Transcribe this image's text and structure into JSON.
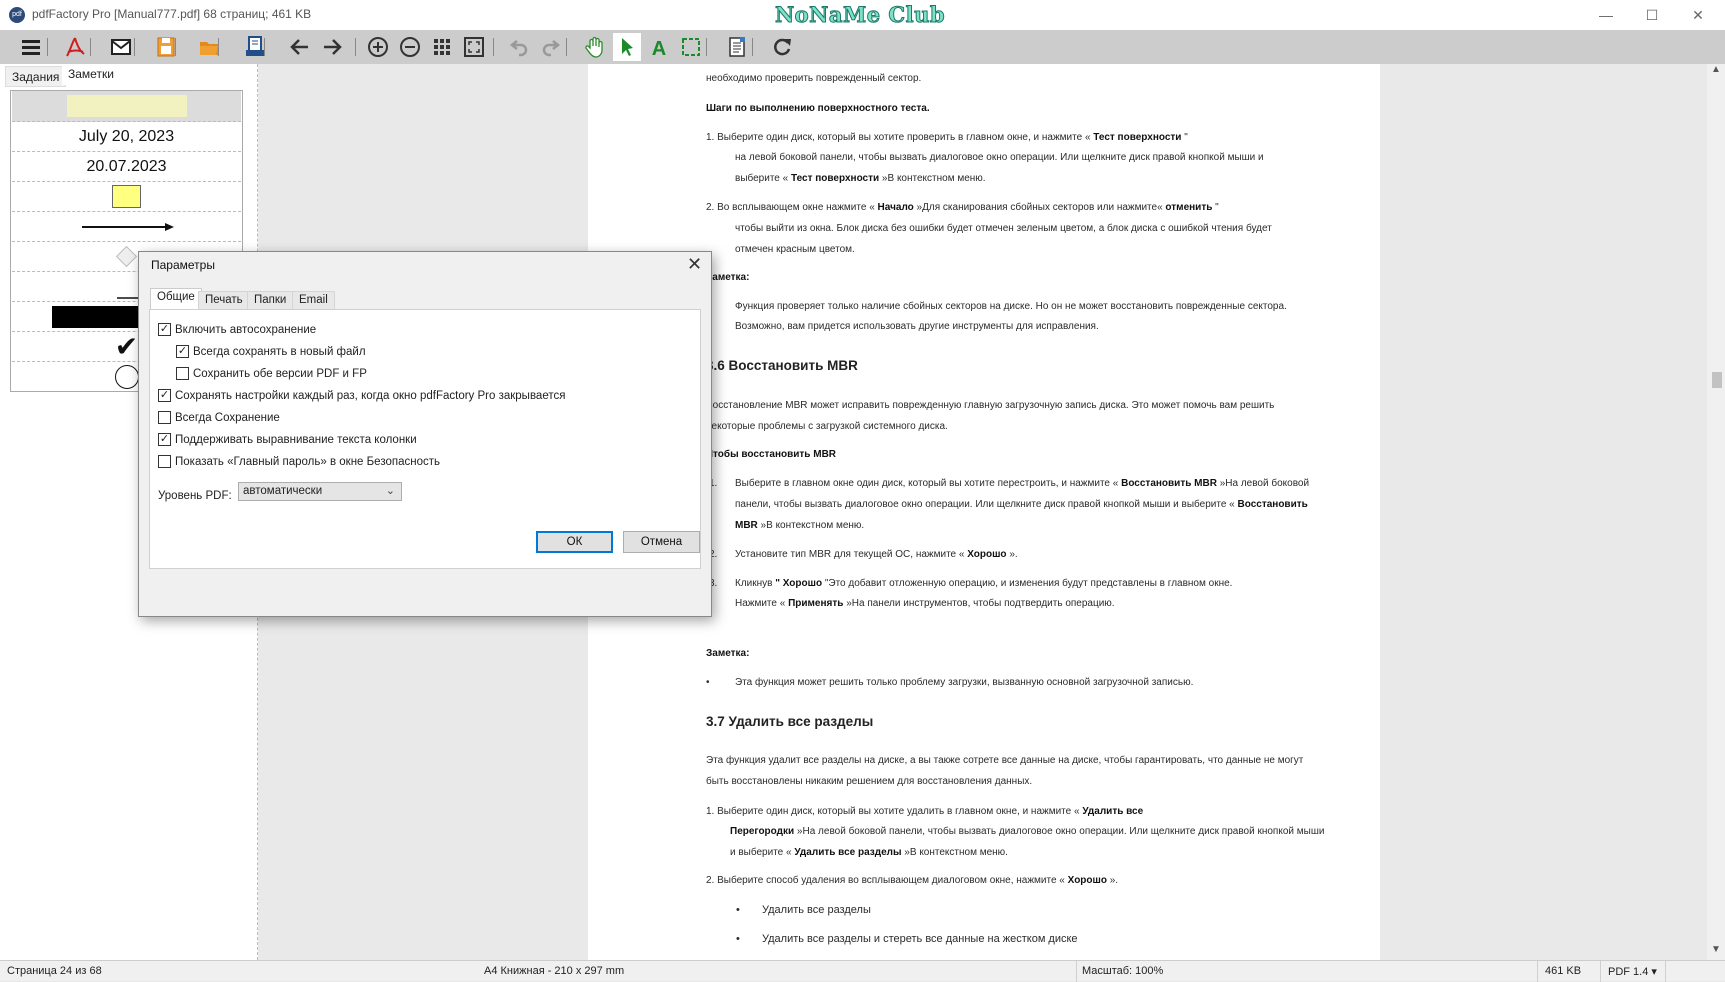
{
  "window": {
    "app_icon_text": "pdf",
    "title": "pdfFactory Pro [Manual777.pdf] 68 страниц; 461 KB",
    "watermark": "NoNaMe Club",
    "controls": {
      "minimize": "—",
      "maximize": "☐",
      "close": "✕"
    }
  },
  "toolbar": {
    "icons": [
      "menu-icon",
      "pdf-icon",
      "email-icon",
      "save-icon",
      "open-folder-icon",
      "print-icon",
      "back-icon",
      "forward-icon",
      "zoom-in-icon",
      "zoom-out-icon",
      "thumbnails-icon",
      "fit-page-icon",
      "undo-icon",
      "redo-icon",
      "hand-icon",
      "select-arrow-icon",
      "text-tool-icon",
      "selection-rect-icon",
      "page-edit-icon",
      "refresh-icon"
    ],
    "active_tool": "select-arrow-icon"
  },
  "left_panel": {
    "tabs": [
      "Задания",
      "Заметки"
    ],
    "active_tab": "Заметки",
    "notes": {
      "date_long": "July 20, 2023",
      "date_short": "20.07.2023",
      "items": [
        "highlight",
        "date-long",
        "date-short",
        "sticky-note",
        "arrow",
        "diamond",
        "line",
        "black-bar",
        "checkmark",
        "circle"
      ]
    }
  },
  "document": {
    "lines": [
      {
        "segs": [
          {
            "t": "необходимо проверить поврежденный сектор."
          }
        ]
      },
      {
        "segs": [
          {
            "t": "Шаги по выполнению поверхностного теста.",
            "b": true
          }
        ]
      },
      {
        "segs": [
          {
            "t": "1. Выберите один диск, который вы хотите проверить в главном окне, и нажмите « "
          },
          {
            "t": "Тест поверхности",
            "b": true
          },
          {
            "t": " \""
          }
        ]
      },
      {
        "segs": [
          {
            "t": "на левой боковой панели, чтобы вызвать диалоговое окно операции. Или щелкните диск правой кнопкой мыши и"
          }
        ]
      },
      {
        "segs": [
          {
            "t": "выберите « "
          },
          {
            "t": "Тест поверхности",
            "b": true
          },
          {
            "t": " »В контекстном меню."
          }
        ]
      },
      {
        "segs": [
          {
            "t": "2. Во всплывающем окне нажмите « "
          },
          {
            "t": "Начало",
            "b": true
          },
          {
            "t": " »Для сканирования сбойных секторов или нажмите« "
          },
          {
            "t": "отменить",
            "b": true
          },
          {
            "t": " \""
          }
        ]
      },
      {
        "segs": [
          {
            "t": "чтобы выйти из окна. Блок диска без ошибки будет отмечен зеленым цветом, а блок диска с ошибкой чтения будет"
          }
        ]
      },
      {
        "segs": [
          {
            "t": "отмечен красным цветом."
          }
        ]
      },
      {
        "segs": [
          {
            "t": "Заметка:",
            "b": true
          }
        ]
      },
      {
        "segs": [
          {
            "t": "Функция проверяет только наличие сбойных секторов на диске. Но он не может восстановить поврежденные сектора."
          }
        ]
      },
      {
        "segs": [
          {
            "t": "Возможно, вам придется использовать другие инструменты для исправления."
          }
        ]
      },
      {
        "heading": true,
        "segs": [
          {
            "t": "3.6 Восстановить MBR"
          }
        ]
      },
      {
        "segs": [
          {
            "t": "Восстановление MBR может исправить поврежденную главную загрузочную запись диска. Это может помочь вам решить"
          }
        ]
      },
      {
        "segs": [
          {
            "t": "некоторые проблемы с загрузкой системного диска."
          }
        ]
      },
      {
        "segs": [
          {
            "t": "Чтобы восстановить MBR",
            "b": true
          }
        ]
      },
      {
        "marker": "1.",
        "segs": [
          {
            "t": "Выберите в главном окне один диск, который вы хотите перестроить, и нажмите « "
          },
          {
            "t": "Восстановить MBR",
            "b": true
          },
          {
            "t": " »На левой боковой"
          }
        ]
      },
      {
        "segs": [
          {
            "t": "панели, чтобы вызвать диалоговое окно операции. Или щелкните диск правой кнопкой мыши и выберите « "
          },
          {
            "t": "Восстановить",
            "b": true
          }
        ]
      },
      {
        "segs": [
          {
            "t": "MBR",
            "b": true
          },
          {
            "t": " »В контекстном меню."
          }
        ]
      },
      {
        "marker": "2.",
        "segs": [
          {
            "t": "Установите тип MBR для текущей ОС, нажмите « "
          },
          {
            "t": "Хорошо",
            "b": true
          },
          {
            "t": " »."
          }
        ]
      },
      {
        "marker": "3.",
        "segs": [
          {
            "t": "Кликнув "
          },
          {
            "t": "\" Хорошо",
            "b": true
          },
          {
            "t": " \"Это добавит отложенную операцию, и изменения будут представлены в главном окне."
          }
        ]
      },
      {
        "segs": [
          {
            "t": "Нажмите « "
          },
          {
            "t": "Применять",
            "b": true
          },
          {
            "t": " »На панели инструментов, чтобы подтвердить операцию."
          }
        ]
      },
      {
        "segs": [
          {
            "t": "Заметка:",
            "b": true
          }
        ]
      },
      {
        "marker": "•",
        "segs": [
          {
            "t": "Эта функция может решить только проблему загрузки, вызванную основной загрузочной записью."
          }
        ]
      },
      {
        "heading": true,
        "segs": [
          {
            "t": "3.7 Удалить все разделы"
          }
        ]
      },
      {
        "segs": [
          {
            "t": "Эта функция удалит все разделы на диске, а вы также сотрете все данные на диске, чтобы гарантировать, что данные не могут"
          }
        ]
      },
      {
        "segs": [
          {
            "t": "быть восстановлены никаким решением для восстановления данных."
          }
        ]
      },
      {
        "segs": [
          {
            "t": "1. Выберите один диск, который вы хотите удалить в главном окне, и нажмите « "
          },
          {
            "t": "Удалить все",
            "b": true
          }
        ]
      },
      {
        "segs": [
          {
            "t": "Перегородки",
            "b": true
          },
          {
            "t": " »На левой боковой панели, чтобы вызвать диалоговое окно операции. Или щелкните диск правой кнопкой мыши"
          }
        ]
      },
      {
        "segs": [
          {
            "t": "и выберите « "
          },
          {
            "t": "Удалить все разделы",
            "b": true
          },
          {
            "t": " »В контекстном меню."
          }
        ]
      },
      {
        "segs": [
          {
            "t": "2. Выберите способ удаления во всплывающем диалоговом окне, нажмите « "
          },
          {
            "t": "Хорошо",
            "b": true
          },
          {
            "t": " »."
          }
        ]
      },
      {
        "marker": "•",
        "segs": [
          {
            "t": "Удалить все разделы"
          }
        ]
      },
      {
        "marker": "•",
        "segs": [
          {
            "t": "Удалить все разделы и стереть все данные на жестком диске"
          }
        ]
      }
    ]
  },
  "dialog": {
    "title": "Параметры",
    "close": "✕",
    "tabs": [
      "Общие",
      "Печать",
      "Папки",
      "Email"
    ],
    "active_tab": "Общие",
    "options": [
      {
        "label": "Включить автосохранение",
        "checked": true
      },
      {
        "label": "Всегда сохранять в новый файл",
        "checked": true
      },
      {
        "label": "Сохранить обе версии PDF и FP",
        "checked": false
      },
      {
        "label": "Сохранять настройки каждый раз, когда окно pdfFactory Pro закрывается",
        "checked": true
      },
      {
        "label": "Всегда Сохранение",
        "checked": false
      },
      {
        "label": "Поддерживать выравнивание текста колонки",
        "checked": true
      },
      {
        "label": "Показать «Главный пароль» в окне Безопасность",
        "checked": false
      }
    ],
    "pdf_level_label": "Уровень PDF:",
    "pdf_level_value": "автоматически",
    "ok_label": "ОК",
    "cancel_label": "Отмена",
    "accent": "#0078d7"
  },
  "statusbar": {
    "page": "Страница 24 из 68",
    "paper": "A4 Книжная - 210 x 297 mm",
    "zoom": "Масштаб: 100%",
    "size": "461 KB",
    "pdf_version": "PDF 1.4 ▾"
  }
}
